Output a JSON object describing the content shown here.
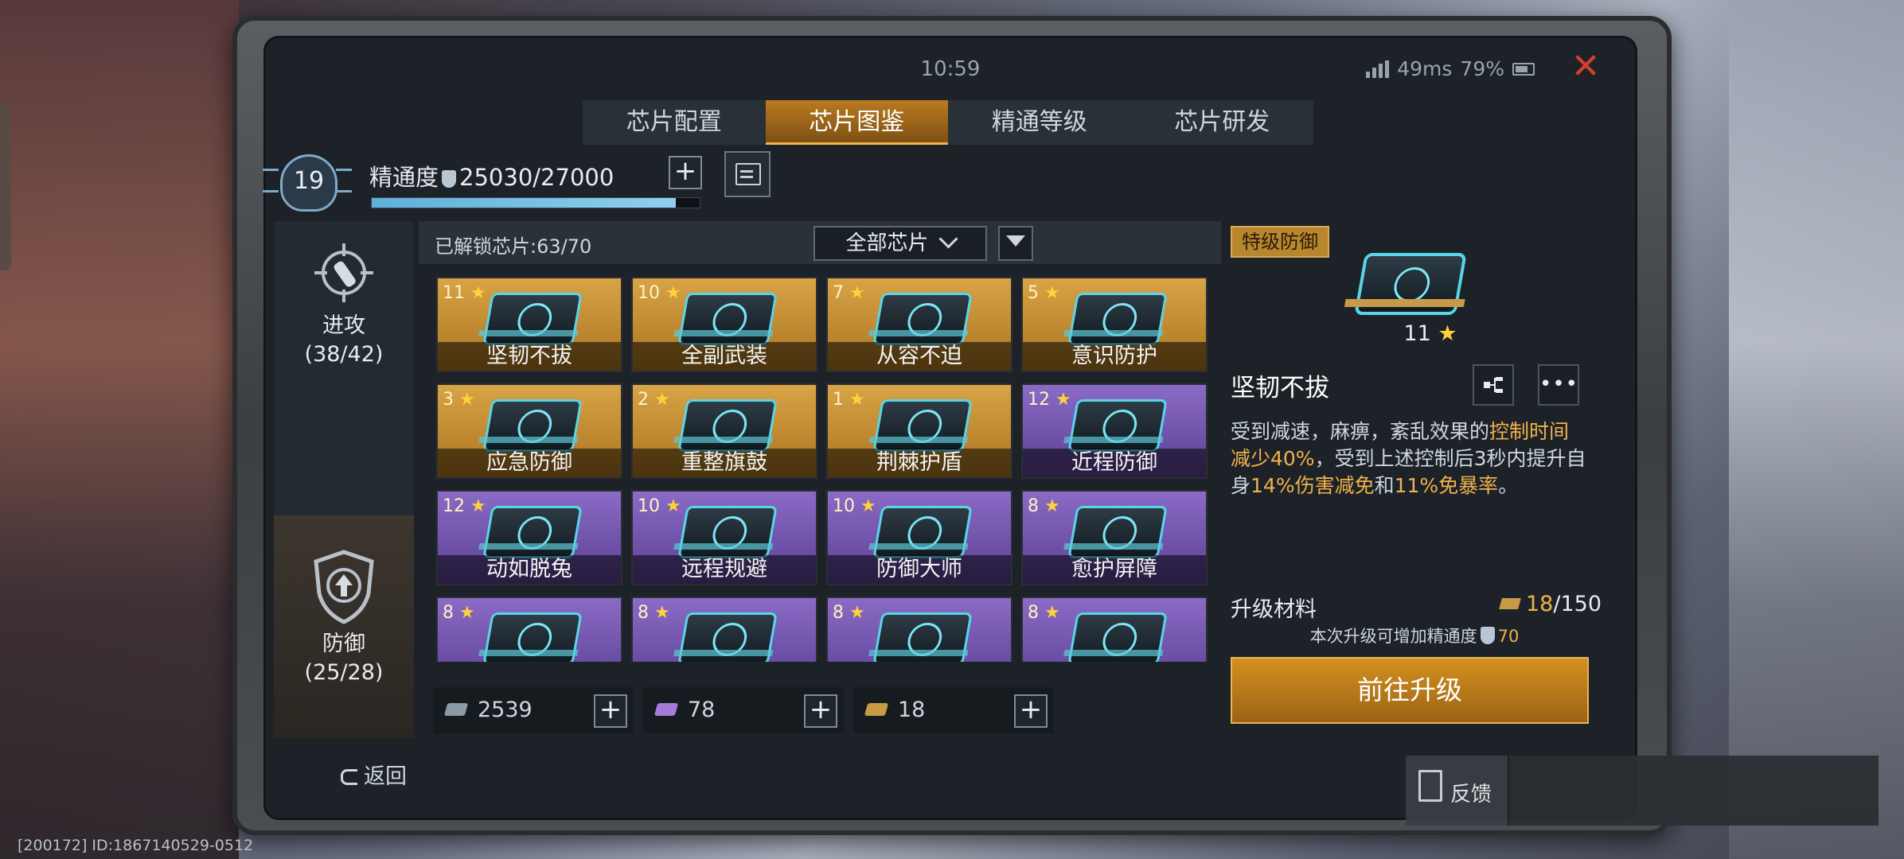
{
  "status": {
    "time": "10:59",
    "ping": "49ms",
    "battery": "79%"
  },
  "tabs": [
    {
      "label": "芯片配置",
      "active": false
    },
    {
      "label": "芯片图鉴",
      "active": true
    },
    {
      "label": "精通等级",
      "active": false
    },
    {
      "label": "芯片研发",
      "active": false
    }
  ],
  "mastery": {
    "level": "19",
    "label": "精通度",
    "value": "25030/27000",
    "progress": 0.927
  },
  "sidebar": [
    {
      "label": "进攻",
      "count": "(38/42)",
      "icon": "crosshair-rocket-icon",
      "active": false
    },
    {
      "label": "防御",
      "count": "(25/28)",
      "icon": "shield-arrow-icon",
      "active": true
    }
  ],
  "collection": {
    "unlocked": "已解锁芯片:63/70",
    "filter": "全部芯片",
    "cards": [
      {
        "stars": "11",
        "name": "坚韧不拔",
        "rarity": "gold"
      },
      {
        "stars": "10",
        "name": "全副武装",
        "rarity": "gold"
      },
      {
        "stars": "7",
        "name": "从容不迫",
        "rarity": "gold"
      },
      {
        "stars": "5",
        "name": "意识防护",
        "rarity": "gold"
      },
      {
        "stars": "3",
        "name": "应急防御",
        "rarity": "gold"
      },
      {
        "stars": "2",
        "name": "重整旗鼓",
        "rarity": "gold"
      },
      {
        "stars": "1",
        "name": "荆棘护盾",
        "rarity": "gold"
      },
      {
        "stars": "12",
        "name": "近程防御",
        "rarity": "purple"
      },
      {
        "stars": "12",
        "name": "动如脱兔",
        "rarity": "purple"
      },
      {
        "stars": "10",
        "name": "远程规避",
        "rarity": "purple"
      },
      {
        "stars": "10",
        "name": "防御大师",
        "rarity": "purple"
      },
      {
        "stars": "8",
        "name": "愈护屏障",
        "rarity": "purple"
      },
      {
        "stars": "8",
        "name": "",
        "rarity": "purple"
      },
      {
        "stars": "8",
        "name": "",
        "rarity": "purple"
      },
      {
        "stars": "8",
        "name": "",
        "rarity": "purple"
      },
      {
        "stars": "8",
        "name": "",
        "rarity": "purple"
      }
    ]
  },
  "resources": [
    {
      "value": "2539",
      "color": "#8a9aa6"
    },
    {
      "value": "78",
      "color": "#a47bd6"
    },
    {
      "value": "18",
      "color": "#c89a48"
    }
  ],
  "detail": {
    "badge": "特级防御",
    "stars": "11",
    "name": "坚韧不拔",
    "desc": {
      "p1": "受到减速，麻痹，紊乱效果的",
      "h1": "控制时间减少40%",
      "p2": "，受到上述控制后3秒内提升自身",
      "h2": "14%伤害减免",
      "p3": "和",
      "h3": "11%免暴率",
      "p4": "。"
    },
    "material_label": "升级材料",
    "material_current": "18",
    "material_total": "/150",
    "hint": "本次升级可增加精通度",
    "hint_value": "70",
    "upgrade_button": "前往升级"
  },
  "back_label": "返回",
  "feedback_label": "反馈",
  "footer": "[200172] ID:1867140529-0512"
}
